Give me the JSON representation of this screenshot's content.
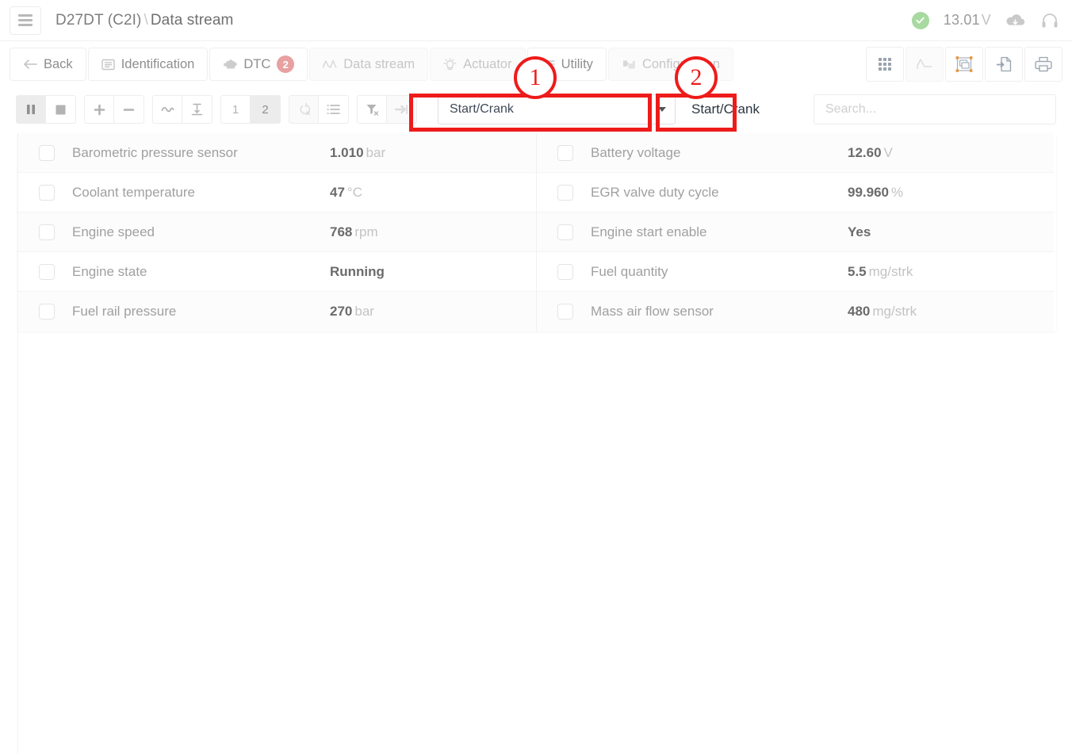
{
  "header": {
    "menu_icon": "hamburger-icon",
    "breadcrumb_model": "D27DT (C2I)",
    "breadcrumb_sep": "\\",
    "breadcrumb_page": "Data stream",
    "status_icon": "check-circle-icon",
    "voltage_value": "13.01",
    "voltage_unit": "V",
    "cloud_icon": "cloud-download-icon",
    "headset_icon": "headset-icon"
  },
  "tabs": {
    "back": "Back",
    "items": [
      {
        "label": "Identification",
        "icon": "list-card-icon",
        "dim": false,
        "badge": null
      },
      {
        "label": "DTC",
        "icon": "engine-icon",
        "dim": false,
        "badge": "2"
      },
      {
        "label": "Data stream",
        "icon": "chart-line-icon",
        "dim": true,
        "badge": null
      },
      {
        "label": "Actuator",
        "icon": "bulb-icon",
        "dim": true,
        "badge": null
      },
      {
        "label": "Utility",
        "icon": "sliders-icon",
        "dim": false,
        "badge": null
      },
      {
        "label": "Configuration",
        "icon": "puzzle-icon",
        "dim": true,
        "badge": null
      }
    ],
    "right_tools": [
      {
        "icon": "grid-view-icon",
        "dim": false
      },
      {
        "icon": "graph-view-icon",
        "dim": true
      },
      {
        "icon": "snapshot-icon",
        "dim": false
      },
      {
        "icon": "export-file-icon",
        "dim": false
      },
      {
        "icon": "print-icon",
        "dim": false
      }
    ]
  },
  "toolbar": {
    "buttons": [
      {
        "name": "pause-button",
        "icon": "pause-icon",
        "label": "",
        "state": "active"
      },
      {
        "name": "stop-button",
        "icon": "stop-icon",
        "label": "",
        "state": "normal"
      },
      {
        "name": "add-button",
        "icon": "plus-icon",
        "label": "",
        "state": "normal"
      },
      {
        "name": "remove-button",
        "icon": "minus-icon",
        "label": "",
        "state": "normal"
      },
      {
        "name": "wave-button",
        "icon": "tilde-icon",
        "label": "",
        "state": "normal"
      },
      {
        "name": "text-height-button",
        "icon": "i-beam-icon",
        "label": "",
        "state": "normal"
      },
      {
        "name": "page-one-button",
        "icon": "",
        "label": "1",
        "state": "normal"
      },
      {
        "name": "page-two-button",
        "icon": "",
        "label": "2",
        "state": "active"
      },
      {
        "name": "clear-record-button",
        "icon": "circle-x-icon",
        "label": "",
        "state": "dim"
      },
      {
        "name": "list-view-button",
        "icon": "list-icon",
        "label": "",
        "state": "normal"
      },
      {
        "name": "clear-filter-button",
        "icon": "filter-x-icon",
        "label": "",
        "state": "normal"
      },
      {
        "name": "jump-end-button",
        "icon": "arrow-to-line-icon",
        "label": "",
        "state": "dim"
      }
    ],
    "mode_select_value": "Start/Crank",
    "mode_select_caret": "chevron-down-icon",
    "mode_label": "Start/Crank",
    "search_placeholder": "Search...",
    "search_value": ""
  },
  "grid": {
    "left": [
      {
        "label": "Barometric pressure sensor",
        "value": "1.010",
        "unit": "bar",
        "checked": false
      },
      {
        "label": "Coolant temperature",
        "value": "47",
        "unit": "°C",
        "checked": false
      },
      {
        "label": "Engine speed",
        "value": "768",
        "unit": "rpm",
        "checked": false
      },
      {
        "label": "Engine state",
        "value": "Running",
        "unit": "",
        "checked": false
      },
      {
        "label": "Fuel rail pressure",
        "value": "270",
        "unit": "bar",
        "checked": false
      }
    ],
    "right": [
      {
        "label": "Battery voltage",
        "value": "12.60",
        "unit": "V",
        "checked": false
      },
      {
        "label": "EGR valve duty cycle",
        "value": "99.960",
        "unit": "%",
        "checked": false
      },
      {
        "label": "Engine start enable",
        "value": "Yes",
        "unit": "",
        "checked": false
      },
      {
        "label": "Fuel quantity",
        "value": "5.5",
        "unit": "mg/strk",
        "checked": false
      },
      {
        "label": "Mass air flow sensor",
        "value": "480",
        "unit": "mg/strk",
        "checked": false
      }
    ]
  },
  "annotations": {
    "color": "#ee1b1b",
    "markers": [
      {
        "number": "1",
        "target": "mode-select"
      },
      {
        "number": "2",
        "target": "mode-label"
      }
    ]
  }
}
